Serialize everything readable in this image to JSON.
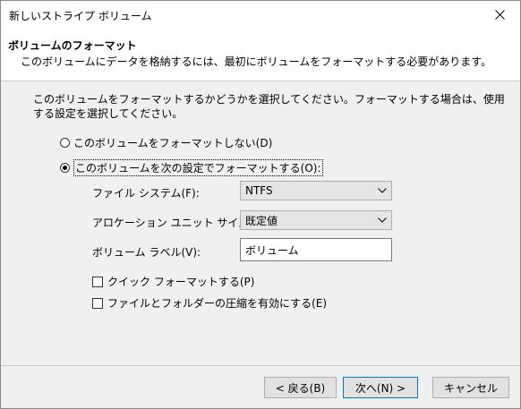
{
  "window": {
    "title": "新しいストライプ ボリューム"
  },
  "header": {
    "title": "ボリュームのフォーマット",
    "subtitle": "このボリュームにデータを格納するには、最初にボリュームをフォーマットする必要があります。"
  },
  "intro": "このボリュームをフォーマットするかどうかを選択してください。フォーマットする場合は、使用する設定を選択してください。",
  "options": {
    "no_format": {
      "label": "このボリュームをフォーマットしない(D)",
      "selected": false
    },
    "format": {
      "label": "このボリュームを次の設定でフォーマットする(O):",
      "selected": true
    }
  },
  "fields": {
    "file_system": {
      "label": "ファイル システム(F):",
      "value": "NTFS"
    },
    "allocation_unit": {
      "label": "アロケーション ユニット サイズ(A):",
      "value": "既定値"
    },
    "volume_label": {
      "label": "ボリューム ラベル(V):",
      "value": "ボリューム"
    }
  },
  "checkboxes": {
    "quick_format": {
      "label": "クイック フォーマットする(P)",
      "checked": false
    },
    "compression": {
      "label": "ファイルとフォルダーの圧縮を有効にする(E)",
      "checked": false
    }
  },
  "buttons": {
    "back": "< 戻る(B)",
    "next": "次へ(N) >",
    "cancel": "キャンセル"
  },
  "icons": {
    "close": "close-icon",
    "dropdown": "chevron-down-icon"
  }
}
